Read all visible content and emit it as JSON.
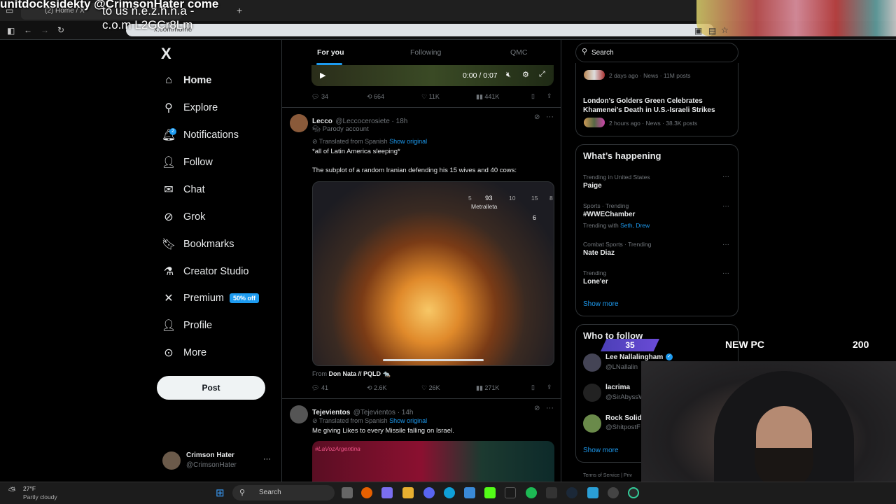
{
  "stream_overlay": {
    "top_left": "unitdocksidekty  @CrimsonHater come",
    "line2": "to us n.e.z.h.n.a -",
    "line3": "c.o.m L2GCr8Lm"
  },
  "browser": {
    "tab_title": "(2) Home / X",
    "url": "x.com/home",
    "new_tab": "+"
  },
  "left_nav": {
    "logo": "X",
    "items": [
      {
        "label": "Home",
        "icon": "home-icon"
      },
      {
        "label": "Explore",
        "icon": "search-icon"
      },
      {
        "label": "Notifications",
        "icon": "bell-icon"
      },
      {
        "label": "Follow",
        "icon": "person-add-icon"
      },
      {
        "label": "Chat",
        "icon": "mail-icon"
      },
      {
        "label": "Grok",
        "icon": "grok-icon"
      },
      {
        "label": "Bookmarks",
        "icon": "bookmark-icon"
      },
      {
        "label": "Creator Studio",
        "icon": "flask-icon"
      },
      {
        "label": "Premium",
        "icon": "x-icon"
      },
      {
        "label": "Profile",
        "icon": "person-icon"
      },
      {
        "label": "More",
        "icon": "more-circle-icon"
      }
    ],
    "notifications_badge": "2",
    "premium_badge": "50% off",
    "post_button": "Post",
    "account": {
      "name": "Crimson Hater",
      "handle": "@CrimsonHater",
      "more": "···"
    }
  },
  "timeline": {
    "tabs": [
      "For you",
      "Following",
      "QMC"
    ],
    "video1": {
      "time": "0:00 / 0:07"
    },
    "tweet0_actions": {
      "replies": "34",
      "reposts": "664",
      "likes": "11K",
      "views": "441K"
    },
    "tweet1": {
      "name": "Lecco",
      "handle": "@Leccocerosiete · 18h",
      "parody": "Parody account",
      "translated": "Translated from Spanish",
      "show_original": "Show original",
      "text1": "*all of Latin America sleeping*",
      "text2": "The subplot of a random Iranian defending his 15 wives and 40 cows:",
      "media_hud": {
        "ammo": "93",
        "weapon": "Metralleta",
        "n5": "5",
        "n10": "10",
        "n15": "15",
        "n8": "8",
        "n6": "6"
      },
      "from_label": "From",
      "from_source": "Don Nata // PQLD 🐀",
      "actions": {
        "replies": "41",
        "reposts": "2.6K",
        "likes": "26K",
        "views": "271K"
      }
    },
    "tweet2": {
      "name": "Tejevientos",
      "handle": "@Tejevientos · 14h",
      "translated": "Translated from Spanish",
      "show_original": "Show original",
      "text": "Me giving Likes to every Missile falling on Israel.",
      "media_tag": "#LaVozArgentina"
    }
  },
  "right": {
    "search_placeholder": "Search",
    "news": [
      {
        "meta": "2 days ago · News · 11M posts"
      },
      {
        "title": "London's Golders Green Celebrates Khamenei's Death in U.S.-Israeli Strikes",
        "meta": "2 hours ago · News · 38.3K posts"
      }
    ],
    "whats_happening": {
      "title": "What’s happening",
      "trends": [
        {
          "context": "Trending in United States",
          "name": "Paige"
        },
        {
          "context": "Sports · Trending",
          "name": "#WWEChamber",
          "with_label": "Trending with",
          "with": "Seth, Drew"
        },
        {
          "context": "Combat Sports · Trending",
          "name": "Nate Diaz"
        },
        {
          "context": "Trending",
          "name": "Lone'er"
        }
      ],
      "show_more": "Show more"
    },
    "who_to_follow": {
      "title": "Who to follow",
      "users": [
        {
          "name": "Lee Nallalingham",
          "handle": "@LNallalin"
        },
        {
          "name": "lacrima",
          "handle": "@SirAbyssW"
        },
        {
          "name": "Rock Solid",
          "handle": "@ShitpostF"
        }
      ],
      "show_more": "Show more"
    },
    "footer": {
      "terms": "Terms of Service",
      "privacy": "Priv"
    }
  },
  "game_overlay": {
    "badge": "35",
    "label": "NEW PC",
    "score": "200"
  },
  "taskbar": {
    "weather_temp": "27°F",
    "weather_desc": "Partly cloudy",
    "search": "Search"
  }
}
